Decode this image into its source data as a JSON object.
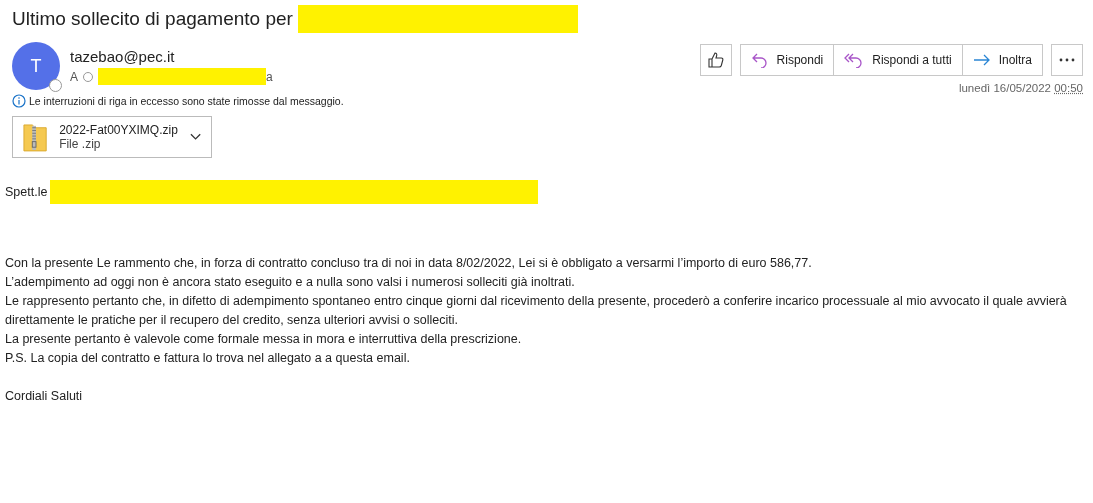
{
  "subject": {
    "text": "Ultimo sollecito di pagamento per"
  },
  "sender": {
    "avatar_letter": "T",
    "email": "tazebao@pec.it",
    "to_label": "A",
    "to_suffix": "a"
  },
  "actions": [
    {
      "kind": "like"
    },
    {
      "kind": "reply",
      "label": "Rispondi"
    },
    {
      "kind": "reply_all",
      "label": "Rispondi a tutti"
    },
    {
      "kind": "forward",
      "label": "Inoltra"
    },
    {
      "kind": "more"
    }
  ],
  "date": {
    "day": "lunedì 16/05/2022",
    "time": "00:50"
  },
  "notice": "Le interruzioni di riga in eccesso sono state rimosse dal messaggio.",
  "attachment": {
    "name": "2022-Fat00YXIMQ.zip",
    "type": "File .zip"
  },
  "body": {
    "greeting": "Spett.le",
    "lines": [
      "Con la presente Le rammento che, in forza di contratto concluso tra di noi in data 8/02/2022, Lei si è obbligato a versarmi l’importo di euro 586,77.",
      "L’adempimento ad oggi non è ancora stato eseguito e a nulla sono valsi i numerosi solleciti già inoltrati.",
      "Le rappresento pertanto che, in difetto di adempimento spontaneo entro cinque giorni dal ricevimento della presente, procederò a conferire incarico processuale al mio avvocato il quale avvierà direttamente le pratiche per il recupero del credito, senza ulteriori avvisi o solleciti.",
      "La presente pertanto è valevole come formale messa in mora e interruttiva della prescrizione.",
      "P.S. La copia del contratto e fattura lo trova nel allegato a a questa email."
    ],
    "closing": "Cordiali Saluti"
  }
}
